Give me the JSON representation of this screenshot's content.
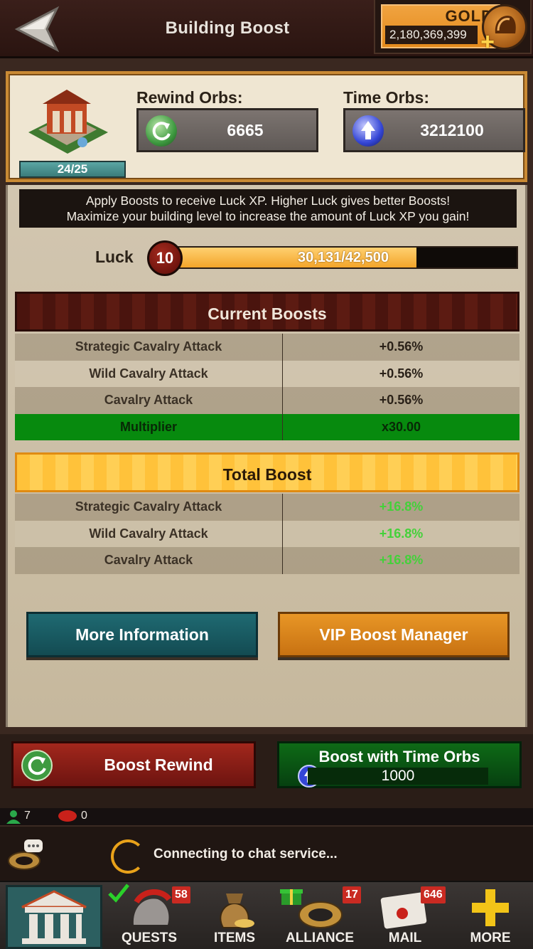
{
  "header": {
    "title": "Building Boost",
    "gold_label": "GOLD",
    "gold_value": "2,180,369,399"
  },
  "building": {
    "level": "24/25"
  },
  "orbs": {
    "rewind_label": "Rewind Orbs:",
    "rewind_value": "6665",
    "time_label": "Time Orbs:",
    "time_value": "3212100"
  },
  "info": {
    "line1": "Apply Boosts to receive Luck XP. Higher Luck gives better Boosts!",
    "line2": "Maximize your building level to increase the amount of Luck XP you gain!"
  },
  "luck": {
    "label": "Luck",
    "level": "10",
    "progress_text": "30,131/42,500",
    "current": 30131,
    "max": 42500
  },
  "current_boosts": {
    "title": "Current Boosts",
    "rows": [
      {
        "name": "Strategic Cavalry Attack",
        "value": "+0.56%"
      },
      {
        "name": "Wild Cavalry Attack",
        "value": "+0.56%"
      },
      {
        "name": "Cavalry Attack",
        "value": "+0.56%"
      }
    ],
    "multiplier": {
      "name": "Multiplier",
      "value": "x30.00"
    }
  },
  "total_boost": {
    "title": "Total Boost",
    "rows": [
      {
        "name": "Strategic Cavalry Attack",
        "value": "+16.8%"
      },
      {
        "name": "Wild Cavalry Attack",
        "value": "+16.8%"
      },
      {
        "name": "Cavalry Attack",
        "value": "+16.8%"
      }
    ]
  },
  "buttons": {
    "more_info": "More Information",
    "vip_manager": "VIP Boost Manager",
    "boost_rewind": "Boost Rewind",
    "boost_time": "Boost with Time Orbs",
    "boost_time_cost": "1000"
  },
  "chat": {
    "online_count": "7",
    "message_count": "0",
    "status": "Connecting to chat service..."
  },
  "nav": {
    "quests": {
      "label": "QUESTS",
      "badge": "58"
    },
    "items": {
      "label": "ITEMS"
    },
    "alliance": {
      "label": "ALLIANCE",
      "badge": "17"
    },
    "mail": {
      "label": "MAIL",
      "badge": "646"
    },
    "more": {
      "label": "MORE"
    }
  },
  "colors": {
    "accent_orange": "#e48a1c",
    "teal_button": "#1f6a72",
    "multiplier_green": "#078a0e",
    "boost_green_text": "#44d13a"
  },
  "icons": {
    "back": "back-arrow-icon",
    "gold": "helmet-coin-icon",
    "rewind_orb": "rewind-orb-icon",
    "time_orb": "time-orb-icon"
  }
}
